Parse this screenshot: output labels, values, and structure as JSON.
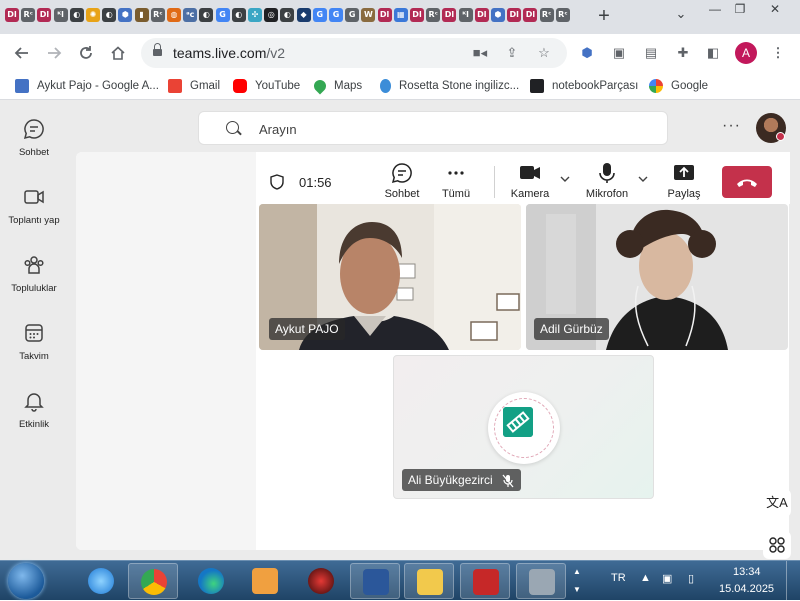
{
  "browser": {
    "tab_favicons": [
      {
        "glyph": "Dl",
        "color": "#b22a54"
      },
      {
        "glyph": "Rᶜ",
        "color": "#5f6368"
      },
      {
        "glyph": "Dl",
        "color": "#b22a54"
      },
      {
        "glyph": "ᴷl",
        "color": "#5f6368"
      },
      {
        "glyph": "◐",
        "color": "#3c4043"
      },
      {
        "glyph": "✺",
        "color": "#e8a317"
      },
      {
        "glyph": "◐",
        "color": "#3c4043"
      },
      {
        "glyph": "⬢",
        "color": "#4472c4"
      },
      {
        "glyph": "▮",
        "color": "#7a5c2e"
      },
      {
        "glyph": "Rᶜ",
        "color": "#5f6368"
      },
      {
        "glyph": "◍",
        "color": "#e06a16"
      },
      {
        "glyph": "ᵃc",
        "color": "#4c6fa5"
      },
      {
        "glyph": "◐",
        "color": "#3c4043"
      },
      {
        "glyph": "G",
        "color": "#4285f4"
      },
      {
        "glyph": "◐",
        "color": "#3c4043"
      },
      {
        "glyph": "✣",
        "color": "#3aa6c4"
      },
      {
        "glyph": "◎",
        "color": "#202124"
      },
      {
        "glyph": "◐",
        "color": "#3c4043"
      },
      {
        "glyph": "◆",
        "color": "#1a3c6e"
      },
      {
        "glyph": "G",
        "color": "#4285f4"
      },
      {
        "glyph": "G",
        "color": "#4285f4"
      },
      {
        "glyph": "G",
        "color": "#5f6368"
      },
      {
        "glyph": "W",
        "color": "#8a6b3f"
      },
      {
        "glyph": "Dl",
        "color": "#b22a54"
      },
      {
        "glyph": "▦",
        "color": "#3b78d8"
      },
      {
        "glyph": "Dl",
        "color": "#b22a54"
      },
      {
        "glyph": "Rᶜ",
        "color": "#5f6368"
      },
      {
        "glyph": "Dl",
        "color": "#b22a54"
      },
      {
        "glyph": "ᴷl",
        "color": "#5f6368"
      },
      {
        "glyph": "Dl",
        "color": "#b22a54"
      },
      {
        "glyph": "⬢",
        "color": "#4472c4"
      },
      {
        "glyph": "Dl",
        "color": "#b22a54"
      },
      {
        "glyph": "Dl",
        "color": "#b22a54"
      },
      {
        "glyph": "Rᶜ",
        "color": "#5f6368"
      },
      {
        "glyph": "Rᶜ",
        "color": "#5f6368"
      }
    ],
    "new_tab": "+",
    "tab_menu": "⌄",
    "window_buttons": [
      "—",
      "❐",
      "✕"
    ],
    "url_host": "teams.live.com",
    "url_path": "/v2",
    "profile_initial": "A",
    "profile_color": "#c2185b",
    "bookmarks": [
      {
        "label": "Aykut Pajo - Google A...",
        "icon": "#4472c4"
      },
      {
        "label": "Gmail",
        "icon": "#ea4335"
      },
      {
        "label": "YouTube",
        "icon": "#ff0000"
      },
      {
        "label": "Maps",
        "icon": "#34a853"
      },
      {
        "label": "Rosetta Stone ingilizc...",
        "icon": "#3c8dd8"
      },
      {
        "label": "notebookParçası",
        "icon": "#202124"
      },
      {
        "label": "Google",
        "icon": "#4285f4"
      }
    ]
  },
  "teams": {
    "search_placeholder": "Arayın",
    "more": "···",
    "rail": [
      {
        "label": "Sohbet",
        "icon": "chat-icon"
      },
      {
        "label": "Toplantı yap",
        "icon": "video-camera-icon"
      },
      {
        "label": "Topluluklar",
        "icon": "communities-icon"
      },
      {
        "label": "Takvim",
        "icon": "calendar-icon"
      },
      {
        "label": "Etkinlik",
        "icon": "bell-icon"
      }
    ],
    "call": {
      "timer": "01:56",
      "chat": "Sohbet",
      "more": "Tümü",
      "camera": "Kamera",
      "mic": "Mikrofon",
      "share": "Paylaş",
      "leave_color": "#c4314b"
    },
    "participants": [
      {
        "name": "Aykut PAJO"
      },
      {
        "name": "Adil Gürbüz"
      },
      {
        "name": "Ali Büyükgezirci",
        "muted": true
      }
    ]
  },
  "taskbar": {
    "language": "TR",
    "time": "13:34",
    "date": "15.04.2025"
  }
}
